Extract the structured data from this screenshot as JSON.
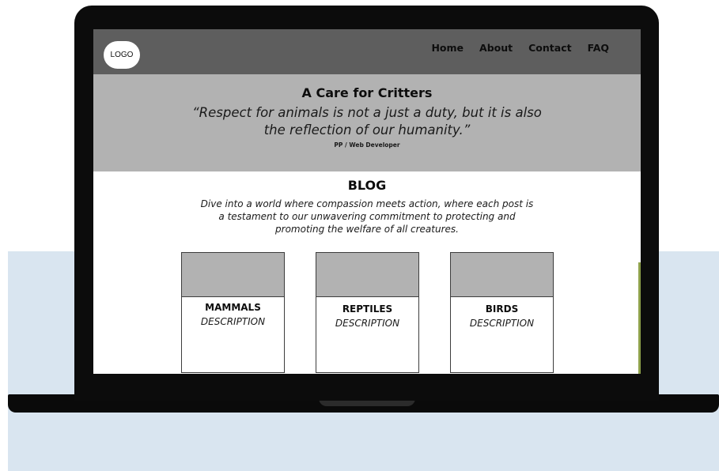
{
  "nav": {
    "logo": "LOGO",
    "links": [
      "Home",
      "About",
      "Contact",
      "FAQ"
    ]
  },
  "hero": {
    "title": "A Care for Critters",
    "quote": "“Respect for animals is not a just a duty, but it is also the reflection of our humanity.”",
    "author": "PP / Web Developer"
  },
  "blog": {
    "title": "BLOG",
    "text": "Dive into a world where compassion meets action, where each post is a testament to our unwavering commitment to protecting and promoting the welfare of all creatures."
  },
  "cards": [
    {
      "title": "MAMMALS",
      "description": "DESCRIPTION"
    },
    {
      "title": "REPTILES",
      "description": "DESCRIPTION"
    },
    {
      "title": "BIRDS",
      "description": "DESCRIPTION"
    }
  ]
}
